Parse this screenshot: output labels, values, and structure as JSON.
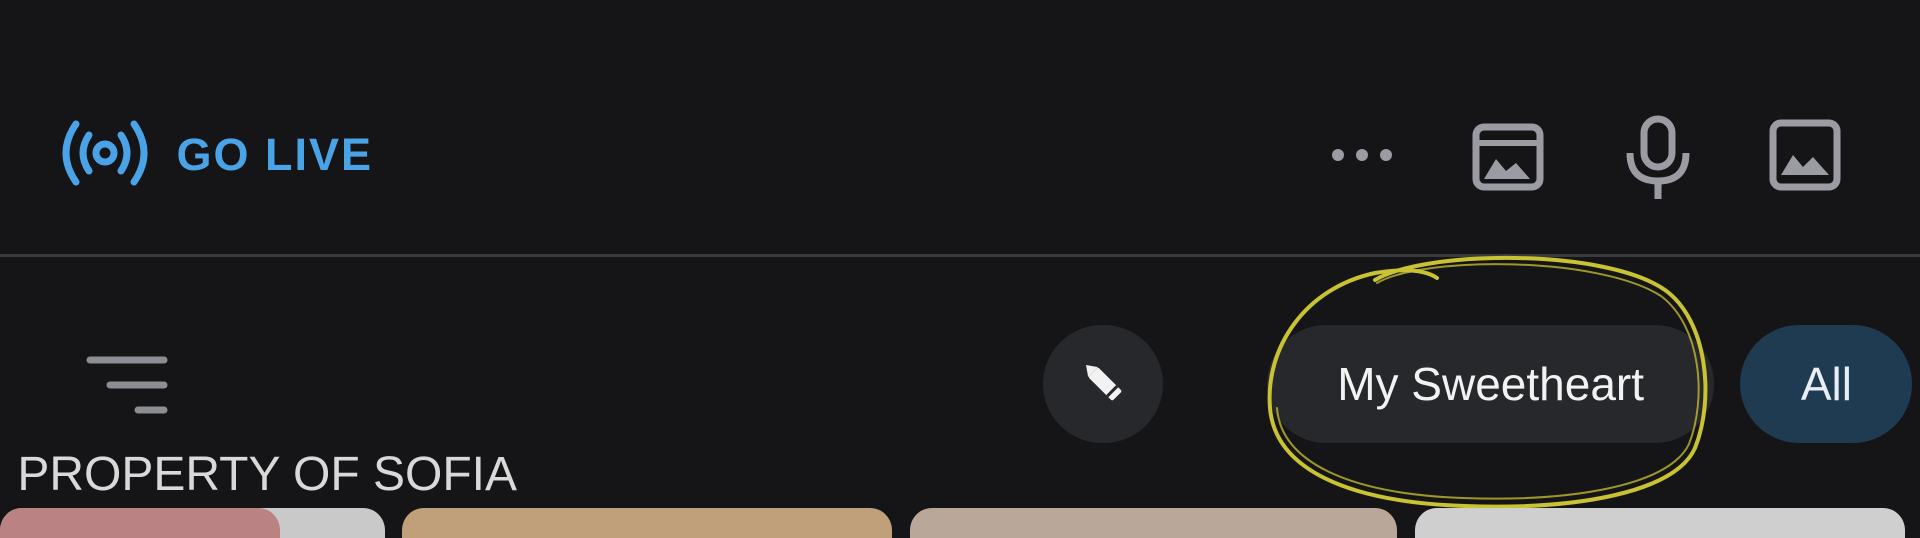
{
  "topbar": {
    "icons": [
      "image-icon",
      "microphone-icon",
      "media-icon",
      "more-icon"
    ],
    "go_live": {
      "label": "GO LIVE",
      "icon": "broadcast-icon",
      "color": "#4aa3e6"
    }
  },
  "chips": {
    "all": "All",
    "my_sweetheart": "My Sweetheart",
    "edit_icon": "pencil-icon"
  },
  "filter_icon": "filter-icon",
  "watermark": "PROPERTY OF SOFIA",
  "colors": {
    "background": "#151517",
    "accent": "#4aa3e6",
    "chip_selected": "#1f3b52",
    "chip": "#26282b",
    "annotation": "#c9c233"
  },
  "thumbnails": [
    "#cfcfcf",
    "#b9a899",
    "#bfa07a",
    "#c9c9c9",
    "#b77070"
  ]
}
